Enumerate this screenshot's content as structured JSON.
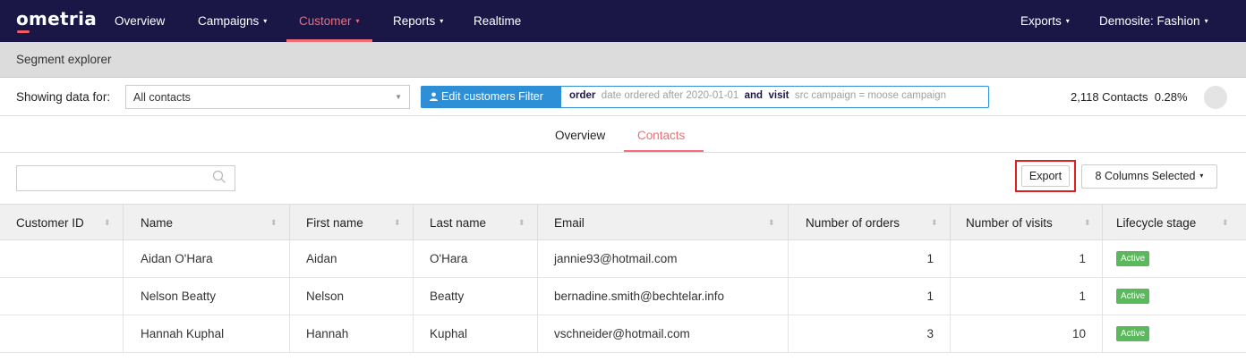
{
  "nav": {
    "logo": "ometria",
    "items": [
      {
        "label": "Overview",
        "caret": ""
      },
      {
        "label": "Campaigns",
        "caret": "▾"
      },
      {
        "label": "Customer",
        "caret": "▾"
      },
      {
        "label": "Reports",
        "caret": "▾"
      },
      {
        "label": "Realtime",
        "caret": ""
      }
    ],
    "right": [
      {
        "label": "Exports",
        "caret": "▾"
      },
      {
        "label": "Demosite: Fashion",
        "caret": "▾"
      }
    ],
    "active": "Customer",
    "accent": "#f26d77",
    "bg": "#1a1747"
  },
  "page": {
    "title": "Segment explorer"
  },
  "filter": {
    "showing_label": "Showing data for:",
    "select_value": "All contacts",
    "edit_button": "Edit customers Filter",
    "clause1_key": "order",
    "clause1_text": "date ordered after 2020-01-01",
    "joiner": "and",
    "clause2_key": "visit",
    "clause2_text": "src campaign = moose campaign",
    "contacts": "2,118 Contacts",
    "percent": "0.28%"
  },
  "tabs": [
    {
      "label": "Overview",
      "active": false
    },
    {
      "label": "Contacts",
      "active": true
    }
  ],
  "toolbar": {
    "search_placeholder": "",
    "export_label": "Export",
    "columns_label": "8 Columns Selected"
  },
  "table": {
    "columns": [
      "Customer ID",
      "Name",
      "First name",
      "Last name",
      "Email",
      "Number of orders",
      "Number of visits",
      "Lifecycle stage"
    ],
    "rows": [
      {
        "id": "",
        "name": "Aidan O'Hara",
        "first": "Aidan",
        "last": "O'Hara",
        "email": "jannie93@hotmail.com",
        "orders": "1",
        "visits": "1",
        "stage": "Active"
      },
      {
        "id": "",
        "name": "Nelson Beatty",
        "first": "Nelson",
        "last": "Beatty",
        "email": "bernadine.smith@bechtelar.info",
        "orders": "1",
        "visits": "1",
        "stage": "Active"
      },
      {
        "id": "",
        "name": "Hannah Kuphal",
        "first": "Hannah",
        "last": "Kuphal",
        "email": "vschneider@hotmail.com",
        "orders": "3",
        "visits": "10",
        "stage": "Active"
      }
    ]
  },
  "colors": {
    "active_badge": "#5cb85c",
    "filter_blue": "#2e8fd6",
    "export_highlight": "#e02020"
  }
}
